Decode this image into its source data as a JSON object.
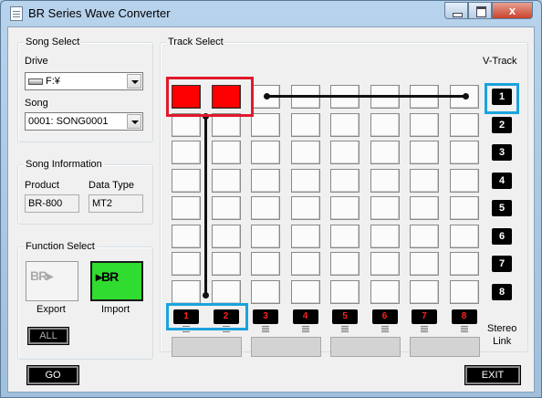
{
  "window": {
    "title": "BR Series Wave Converter",
    "close_glyph": "x"
  },
  "song_select": {
    "group_label": "Song Select",
    "drive_label": "Drive",
    "drive_value": "F:¥",
    "song_label": "Song",
    "song_value": "0001: SONG0001"
  },
  "song_info": {
    "group_label": "Song Information",
    "product_label": "Product",
    "product_value": "BR-800",
    "data_type_label": "Data Type",
    "data_type_value": "MT2"
  },
  "function_select": {
    "group_label": "Function Select",
    "export_label": "Export",
    "import_label": "Import",
    "export_art": "BR▸",
    "import_art": "▸BR",
    "all_label": "ALL"
  },
  "track_select": {
    "group_label": "Track Select",
    "vtrack_label": "V-Track",
    "vtracks": [
      "1",
      "2",
      "3",
      "4",
      "5",
      "6",
      "7",
      "8"
    ],
    "tracks": [
      "1",
      "2",
      "3",
      "4",
      "5",
      "6",
      "7",
      "8"
    ],
    "stereo_link_label": "Stereo\nLink",
    "selected_cells": [
      [
        0,
        0
      ],
      [
        0,
        1
      ]
    ]
  },
  "footer": {
    "go_label": "GO",
    "exit_label": "EXIT"
  },
  "colors": {
    "selected": "#ff0000",
    "highlight_red": "#e0192c",
    "highlight_blue": "#1aa3dd",
    "import_bg": "#2fdc2f"
  }
}
